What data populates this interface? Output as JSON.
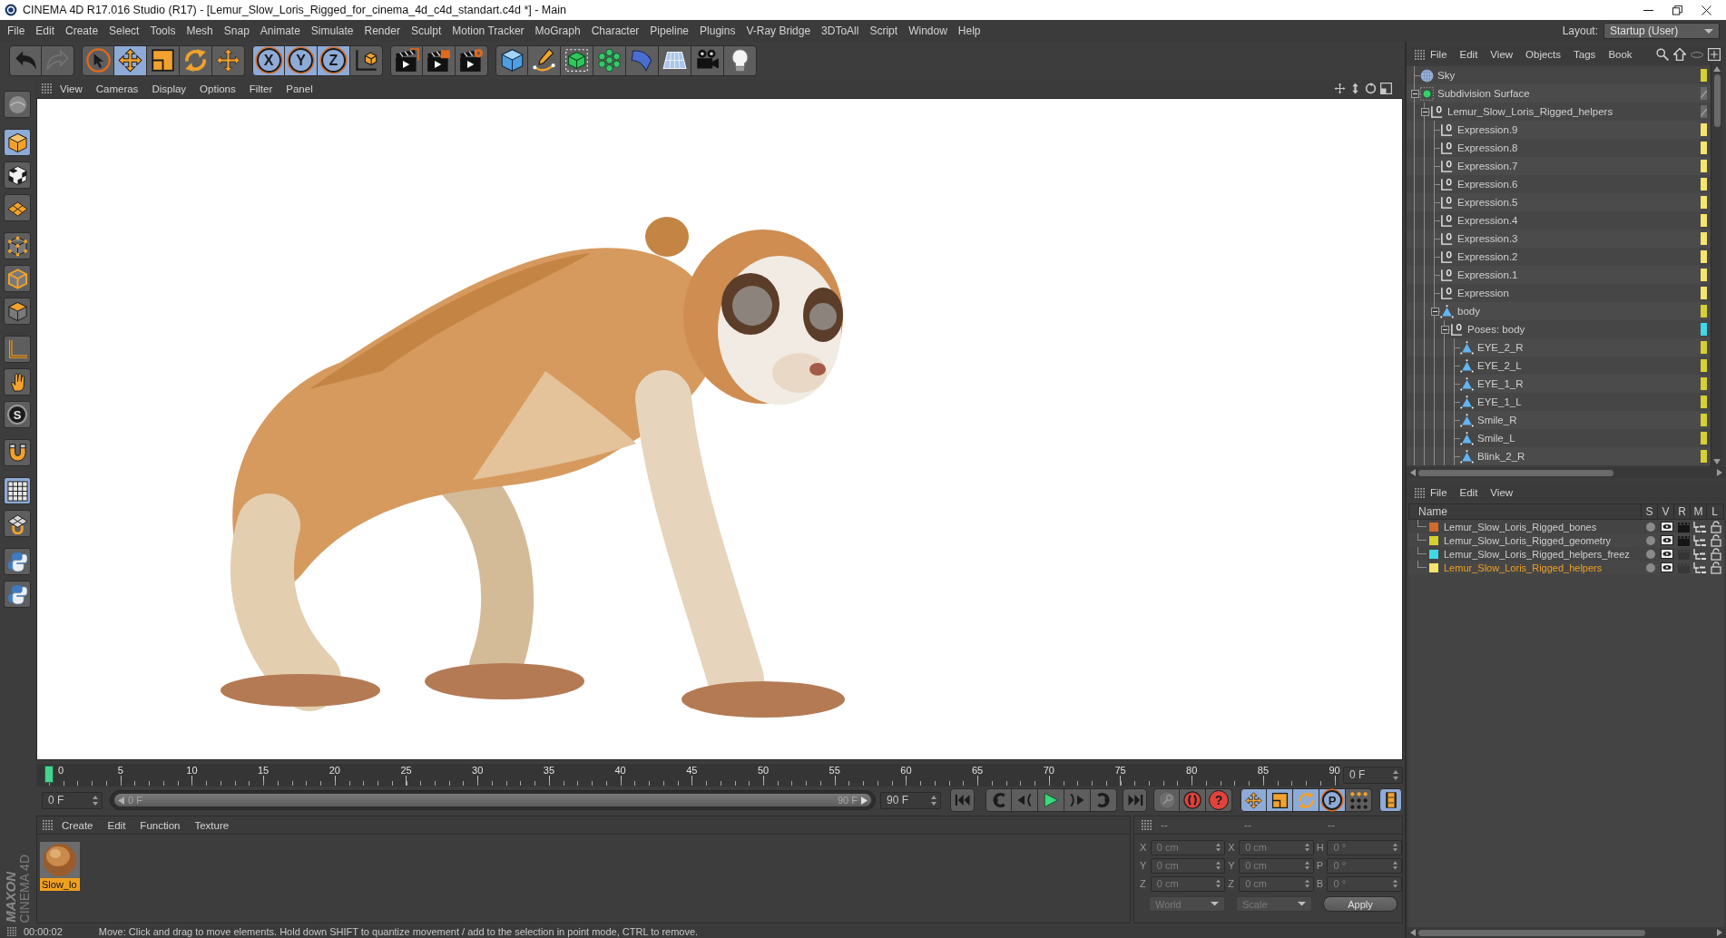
{
  "window": {
    "title": "CINEMA 4D R17.016 Studio (R17) - [Lemur_Slow_Loris_Rigged_for_cinema_4d_c4d_standart.c4d *] - Main"
  },
  "menu_bar": {
    "items": [
      "File",
      "Edit",
      "Create",
      "Select",
      "Tools",
      "Mesh",
      "Snap",
      "Animate",
      "Simulate",
      "Render",
      "Sculpt",
      "Motion Tracker",
      "MoGraph",
      "Character",
      "Pipeline",
      "Plugins",
      "V-Ray Bridge",
      "3DToAll",
      "Script",
      "Window",
      "Help"
    ],
    "layout_label": "Layout:",
    "layout_value": "Startup (User)"
  },
  "toolbar": {
    "groups": [
      {
        "items": [
          {
            "kind": "undo",
            "selected": false
          },
          {
            "kind": "redo",
            "selected": false
          }
        ]
      },
      {
        "items": [
          {
            "kind": "select",
            "selected": false
          },
          {
            "kind": "move",
            "selected": true
          },
          {
            "kind": "scale",
            "selected": false
          },
          {
            "kind": "rotate",
            "selected": false
          },
          {
            "kind": "transform",
            "selected": false
          }
        ]
      },
      {
        "items": [
          {
            "kind": "axis",
            "label": "X",
            "selected": true
          },
          {
            "kind": "axis",
            "label": "Y",
            "selected": true
          },
          {
            "kind": "axis",
            "label": "Z",
            "selected": true
          },
          {
            "kind": "coords",
            "selected": false
          }
        ]
      },
      {
        "items": [
          {
            "kind": "render_view",
            "selected": false
          },
          {
            "kind": "render",
            "selected": false
          },
          {
            "kind": "render_settings",
            "selected": false
          }
        ]
      },
      {
        "items": [
          {
            "kind": "cube",
            "selected": false
          },
          {
            "kind": "pen",
            "selected": false
          },
          {
            "kind": "subdivision",
            "selected": false
          },
          {
            "kind": "cloner",
            "selected": false
          },
          {
            "kind": "deformer",
            "selected": false
          },
          {
            "kind": "floor",
            "selected": false
          },
          {
            "kind": "camera",
            "selected": false
          },
          {
            "kind": "light",
            "selected": false
          }
        ]
      }
    ]
  },
  "left_toolbar": {
    "groups": [
      {
        "items": [
          {
            "kind": "editable",
            "selected": false
          }
        ]
      },
      {
        "items": [
          {
            "kind": "model",
            "selected": true
          },
          {
            "kind": "texture",
            "selected": false
          },
          {
            "kind": "workplane",
            "selected": false
          }
        ]
      },
      {
        "items": [
          {
            "kind": "points",
            "selected": false
          },
          {
            "kind": "edges",
            "selected": false
          },
          {
            "kind": "polygons",
            "selected": false
          }
        ]
      },
      {
        "items": [
          {
            "kind": "axis",
            "selected": false
          },
          {
            "kind": "tweak",
            "selected": false
          },
          {
            "kind": "snap",
            "label": "S",
            "selected": false
          }
        ]
      },
      {
        "items": [
          {
            "kind": "magnet",
            "selected": false
          }
        ]
      },
      {
        "items": [
          {
            "kind": "grid",
            "selected": true
          },
          {
            "kind": "grid_snap",
            "selected": false
          }
        ]
      },
      {
        "items": [
          {
            "kind": "script",
            "selected": false
          },
          {
            "kind": "script",
            "selected": false
          }
        ]
      }
    ]
  },
  "viewport": {
    "menu": [
      "View",
      "Cameras",
      "Display",
      "Options",
      "Filter",
      "Panel"
    ]
  },
  "object_manager": {
    "menu": [
      "File",
      "Edit",
      "View",
      "Objects",
      "Tags",
      "Book"
    ],
    "tree": [
      {
        "name": "Sky",
        "kind": "sky",
        "color": "#d6d030"
      },
      {
        "name": "Subdivision Surface",
        "kind": "subdivision",
        "expanded": true,
        "children": [
          {
            "name": "Lemur_Slow_Loris_Rigged_helpers",
            "kind": "null",
            "expanded": true,
            "children": [
              {
                "name": "Expression.9",
                "kind": "null",
                "color": "#f6e46c"
              },
              {
                "name": "Expression.8",
                "kind": "null",
                "color": "#f6e46c"
              },
              {
                "name": "Expression.7",
                "kind": "null",
                "color": "#f6e46c"
              },
              {
                "name": "Expression.6",
                "kind": "null",
                "color": "#f6e46c"
              },
              {
                "name": "Expression.5",
                "kind": "null",
                "color": "#f6e46c"
              },
              {
                "name": "Expression.4",
                "kind": "null",
                "color": "#f6e46c"
              },
              {
                "name": "Expression.3",
                "kind": "null",
                "color": "#f6e46c"
              },
              {
                "name": "Expression.2",
                "kind": "null",
                "color": "#f6e46c"
              },
              {
                "name": "Expression.1",
                "kind": "null",
                "color": "#f6e46c"
              },
              {
                "name": "Expression",
                "kind": "null",
                "color": "#f6e46c"
              },
              {
                "name": "body",
                "kind": "polygon",
                "color": "#d6d030",
                "expanded": true,
                "children": [
                  {
                    "name": "Poses: body",
                    "kind": "null",
                    "color": "#40d8e6",
                    "expanded": true,
                    "children": [
                      {
                        "name": "EYE_2_R",
                        "kind": "polygon",
                        "color": "#d6d030"
                      },
                      {
                        "name": "EYE_2_L",
                        "kind": "polygon",
                        "color": "#d6d030"
                      },
                      {
                        "name": "EYE_1_R",
                        "kind": "polygon",
                        "color": "#d6d030"
                      },
                      {
                        "name": "EYE_1_L",
                        "kind": "polygon",
                        "color": "#d6d030"
                      },
                      {
                        "name": "Smile_R",
                        "kind": "polygon",
                        "color": "#d6d030"
                      },
                      {
                        "name": "Smile_L",
                        "kind": "polygon",
                        "color": "#d6d030"
                      },
                      {
                        "name": "Blink_2_R",
                        "kind": "polygon",
                        "color": "#d6d030"
                      }
                    ]
                  }
                ]
              }
            ]
          }
        ]
      }
    ]
  },
  "layer_manager": {
    "menu": [
      "File",
      "Edit",
      "View"
    ],
    "columns": [
      "Name",
      "S",
      "V",
      "R",
      "M",
      "L"
    ],
    "rows": [
      {
        "name": "Lemur_Slow_Loris_Rigged_bones",
        "color": "#d4692c",
        "render": true,
        "selected": false
      },
      {
        "name": "Lemur_Slow_Loris_Rigged_geometry",
        "color": "#d6d030",
        "render": true,
        "selected": false
      },
      {
        "name": "Lemur_Slow_Loris_Rigged_helpers_freez",
        "color": "#40d8e6",
        "render": false,
        "selected": false
      },
      {
        "name": "Lemur_Slow_Loris_Rigged_helpers",
        "color": "#f6e46c",
        "render": false,
        "selected": true
      }
    ]
  },
  "timeline": {
    "labels": [
      "0",
      "5",
      "10",
      "15",
      "20",
      "25",
      "30",
      "35",
      "40",
      "45",
      "50",
      "55",
      "60",
      "65",
      "70",
      "75",
      "80",
      "85",
      "90"
    ],
    "playhead": {
      "level": 0
    },
    "current_frame": "0 F"
  },
  "frame_range": {
    "start": "0 F",
    "slider_start": "0 F",
    "slider_end": "90 F",
    "level": 1,
    "end": "90 F"
  },
  "animation_buttons": {
    "keys": [
      {
        "kind": "key"
      },
      {
        "kind": "record"
      },
      {
        "kind": "autokey",
        "label": "?"
      }
    ],
    "modes": [
      {
        "kind": "move",
        "selected": true
      },
      {
        "kind": "scale",
        "selected": true
      },
      {
        "kind": "rotate",
        "selected": true
      },
      {
        "kind": "param",
        "label": "P",
        "selected": true
      },
      {
        "kind": "points",
        "selected": false
      }
    ],
    "timeline_toggle": {
      "selected": true
    }
  },
  "material_manager": {
    "menu": [
      "Create",
      "Edit",
      "Function",
      "Texture"
    ],
    "materials": [
      {
        "name": "Slow_lo",
        "selected": true
      }
    ]
  },
  "coordinates": {
    "headers": [
      "--",
      "--",
      "--"
    ],
    "rows": [
      {
        "fields": [
          {
            "axis": "X",
            "value": "0 cm"
          },
          {
            "axis": "X",
            "value": "0 cm"
          },
          {
            "axis": "H",
            "value": "0 °"
          }
        ]
      },
      {
        "fields": [
          {
            "axis": "Y",
            "value": "0 cm"
          },
          {
            "axis": "Y",
            "value": "0 cm"
          },
          {
            "axis": "P",
            "value": "0 °"
          }
        ]
      },
      {
        "fields": [
          {
            "axis": "Z",
            "value": "0 cm"
          },
          {
            "axis": "Z",
            "value": "0 cm"
          },
          {
            "axis": "B",
            "value": "0 °"
          }
        ]
      }
    ],
    "dropdowns": [
      "World",
      "Scale"
    ],
    "apply": "Apply"
  },
  "status_bar": {
    "time": "00:00:02",
    "message": "Move: Click and drag to move elements. Hold down SHIFT to quantize movement / add to the selection in point mode, CTRL to remove."
  },
  "logo": {
    "brand": "MAXON",
    "product": "CINEMA 4D"
  }
}
